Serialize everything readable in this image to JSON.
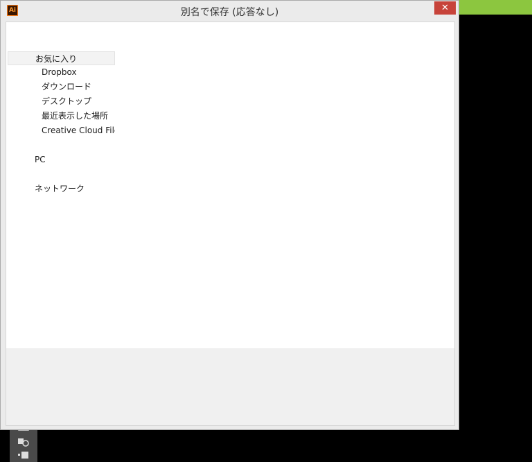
{
  "window": {
    "title": "別名で保存 (応答なし)",
    "app_icon": "Ai",
    "close_glyph": "✕"
  },
  "nav": {
    "favorites_label": "お気に入り",
    "favorites": [
      "Dropbox",
      "ダウンロード",
      "デスクトップ",
      "最近表示した場所",
      "Creative Cloud Files"
    ],
    "pc_label": "PC",
    "network_label": "ネットワーク"
  },
  "colors": {
    "accent_green": "#8cc63f",
    "close_red": "#c7433a",
    "ai_orange": "#ff7f18"
  }
}
